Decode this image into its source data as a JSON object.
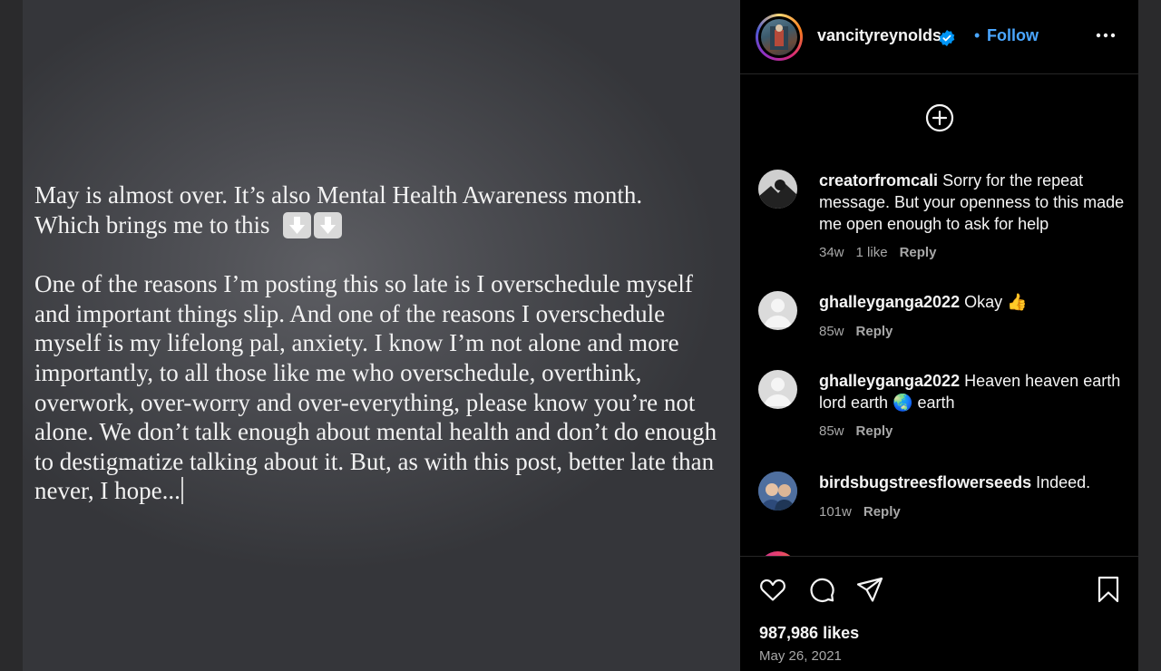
{
  "post": {
    "caption_line1": "May is almost over. It’s also Mental Health Awareness month.",
    "caption_line2": "Which brings me to this",
    "emoji": "down-arrow-emoji",
    "caption_paragraph": "One of the reasons I’m posting this so late is I overschedule myself and important things slip. And one of the reasons I overschedule myself is my lifelong pal, anxiety. I know I’m not alone and more importantly, to all those like me who overschedule, overthink, overwork, over-worry and over-everything, please know you’re not alone. We don’t talk enough about mental health and don’t do enough to destigmatize talking about it. But, as with this post, better late than never, I hope..."
  },
  "header": {
    "username": "vancityreynolds",
    "separator": "•",
    "follow_label": "Follow"
  },
  "comments": [
    {
      "user": "creatorfromcali",
      "text": "Sorry for the repeat message. But your openness to this made me open enough to ask for help",
      "age": "34w",
      "likes": "1 like",
      "reply": "Reply"
    },
    {
      "user": "ghalleyganga2022",
      "text": "Okay 👍",
      "age": "85w",
      "reply": "Reply"
    },
    {
      "user": "ghalleyganga2022",
      "text": "Heaven heaven earth lord earth 🌏 earth",
      "age": "85w",
      "reply": "Reply"
    },
    {
      "user": "birdsbugstreesflowerseeds",
      "text": "Indeed.",
      "age": "101w",
      "reply": "Reply"
    }
  ],
  "footer": {
    "likes": "987,986 likes",
    "date": "May 26, 2021"
  },
  "colors": {
    "link_blue": "#4aa6ff",
    "verified_blue": "#0095f6",
    "muted": "#a8a8a8"
  }
}
